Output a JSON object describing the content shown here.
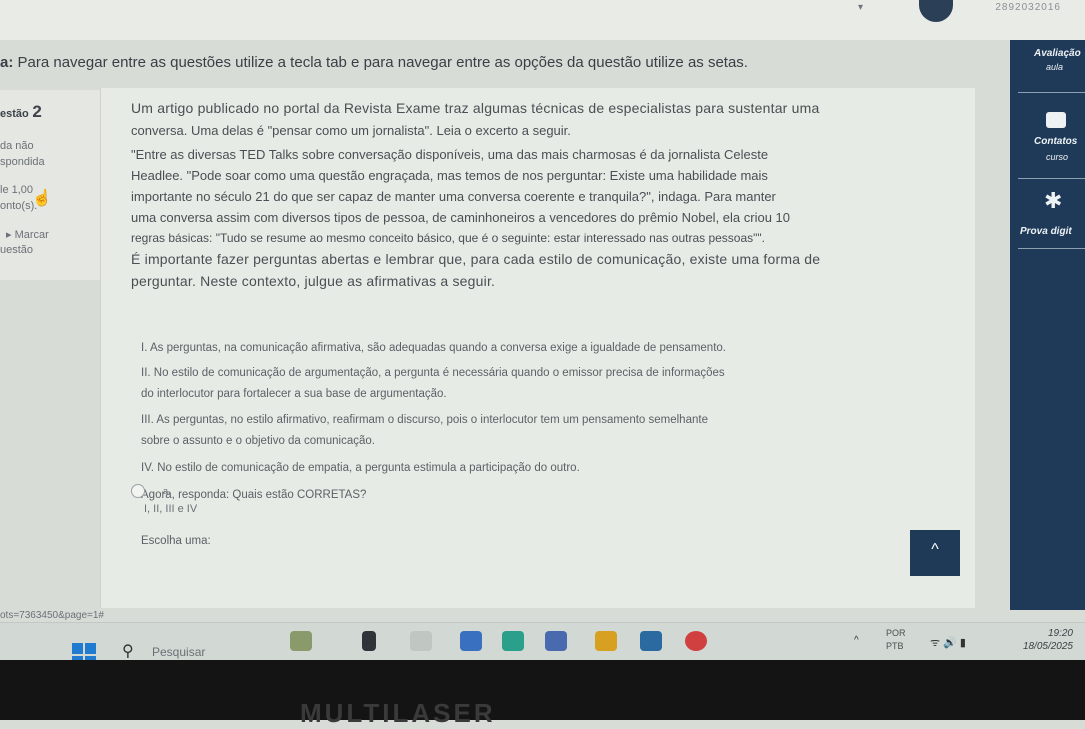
{
  "header": {
    "user_id": "2892032016"
  },
  "instructions": {
    "prefix": "a:",
    "text": "Para navegar entre as questões utilize a tecla tab e para navegar entre as opções da questão utilize as setas."
  },
  "question_panel": {
    "number_label": "estão",
    "number": "2",
    "status_line1": "da não",
    "status_line2": "spondida",
    "score": "le 1,00",
    "score2": "onto(s).",
    "mark_label": "Marcar",
    "mark_label2": "uestão"
  },
  "question": {
    "intro1": "Um artigo publicado no portal da Revista Exame traz algumas técnicas de especialistas para sustentar uma",
    "intro2": "conversa. Uma delas é \"pensar como um jornalista\". Leia o excerto a seguir.",
    "quote1": "\"Entre as diversas TED Talks sobre conversação disponíveis, uma das mais charmosas é da jornalista Celeste",
    "quote2": "Headlee. \"Pode soar como uma questão engraçada, mas temos de nos perguntar: Existe uma habilidade mais",
    "quote3": "importante no século 21 do que ser capaz de manter uma conversa coerente e tranquila?\", indaga. Para manter",
    "quote4": "uma conversa assim com diversos tipos de pessoa, de caminhoneiros a vencedores do prêmio Nobel, ela criou 10",
    "quote5": "regras básicas: \"Tudo se resume ao mesmo conceito básico, que é o seguinte: estar interessado nas outras pessoas\"\".",
    "after1": "É importante fazer perguntas abertas e lembrar que, para cada estilo de comunicação, existe uma forma de",
    "after2": "perguntar. Neste contexto, julgue as afirmativas a seguir.",
    "item1": "I. As perguntas, na comunicação afirmativa, são adequadas quando a conversa exige a igualdade de pensamento.",
    "item2a": "II. No estilo de comunicação de argumentação, a pergunta é necessária quando o emissor precisa de informações",
    "item2b": "do interlocutor para fortalecer a sua base de argumentação.",
    "item3a": "III. As perguntas, no estilo afirmativo, reafirmam o discurso, pois o interlocutor tem um pensamento semelhante",
    "item3b": "sobre o assunto e o objetivo da comunicação.",
    "item4": "IV. No estilo de comunicação de empatia, a pergunta estimula a participação do outro.",
    "prompt": "Agora, responda: Quais estão CORRETAS?",
    "choose": "Escolha uma:",
    "options": [
      {
        "letter": "a.",
        "text": "I, II, III e IV"
      }
    ]
  },
  "sidebar": {
    "avaliacao": "Avaliação",
    "aula": "aula",
    "contatos": "Contatos",
    "curso": "curso",
    "prova": "Prova digit"
  },
  "status_url": "ots=7363450&page=1#",
  "taskbar": {
    "search_placeholder": "Pesquisar",
    "lang1": "POR",
    "lang2": "PTB",
    "time": "19:20",
    "date": "18/05/2025"
  },
  "bezel_brand": "MULTILASER",
  "colors": {
    "accent": "#1e3a58",
    "windows_blue": "#1f7ad0"
  }
}
